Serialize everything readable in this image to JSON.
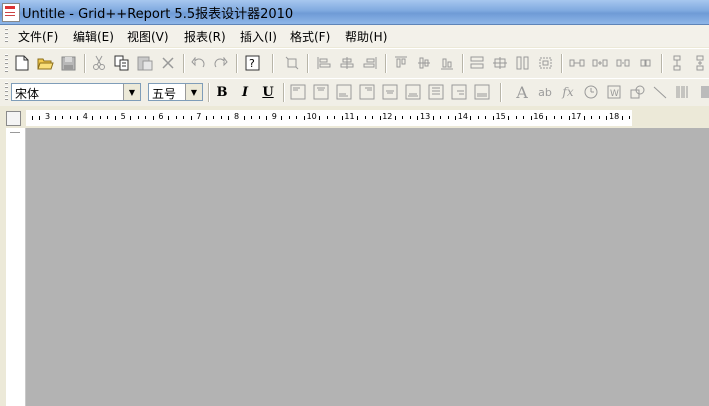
{
  "window": {
    "title": "Untitle - Grid++Report 5.5报表设计器2010"
  },
  "menu": [
    {
      "label": "文件(F)"
    },
    {
      "label": "编辑(E)"
    },
    {
      "label": "视图(V)"
    },
    {
      "label": "报表(R)"
    },
    {
      "label": "插入(I)"
    },
    {
      "label": "格式(F)"
    },
    {
      "label": "帮助(H)"
    }
  ],
  "toolbar1": {
    "icons": [
      "new-file-icon",
      "open-folder-icon",
      "save-icon",
      "cut-icon",
      "copy-icon",
      "paste-icon",
      "delete-icon",
      "undo-icon",
      "redo-icon",
      "help-icon",
      "select-all-icon",
      "align-left-icon",
      "align-center-icon",
      "align-right-icon",
      "align-top-icon",
      "align-middle-icon",
      "align-bottom-icon",
      "same-width-icon",
      "same-size-icon",
      "same-height-icon",
      "size-grid-icon",
      "horizontal-spacing-icon",
      "increase-hspace-icon",
      "decrease-hspace-icon",
      "remove-hspace-icon",
      "vertical-spacing-icon",
      "increase-vspace-icon"
    ]
  },
  "toolbar2": {
    "font_name": "宋体",
    "font_size": "五号",
    "bold_label": "B",
    "italic_label": "I",
    "underline_label": "U",
    "align_icons": [
      "text-align-top-left-icon",
      "text-align-top-center-icon",
      "text-align-bottom-left-icon",
      "text-align-top-right-icon",
      "text-align-center-icon",
      "text-align-bottom-center-icon",
      "text-align-middle-right-icon",
      "text-align-bottom-right-icon",
      "text-align-justify-icon"
    ],
    "insert_icons": [
      "static-text-icon",
      "field-box-icon",
      "formula-icon",
      "system-var-icon",
      "memo-icon",
      "shape-icon",
      "line-icon",
      "barcode-icon"
    ]
  },
  "ruler": {
    "numbers": [
      "3",
      "4",
      "5",
      "6",
      "7",
      "8",
      "9",
      "10",
      "11",
      "12",
      "13",
      "14",
      "15",
      "16",
      "17",
      "18"
    ]
  }
}
